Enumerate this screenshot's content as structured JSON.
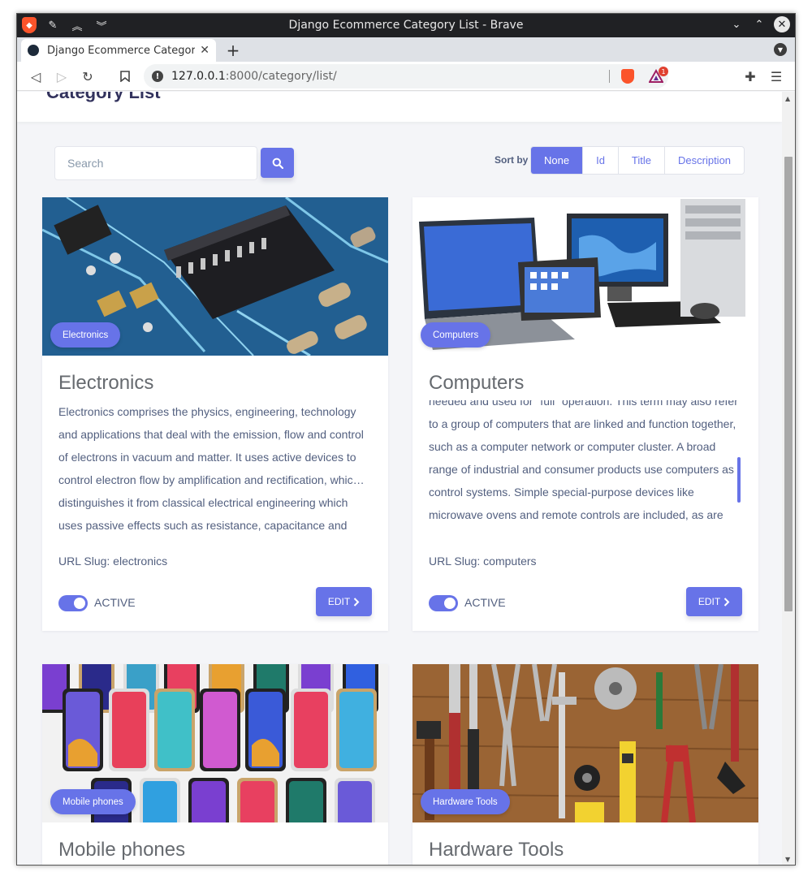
{
  "browser": {
    "window_title": "Django Ecommerce Category List - Brave",
    "tab_title": "Django Ecommerce Categor",
    "url_host": "127.0.0.1",
    "url_path": ":8000/category/list/",
    "rewards_badge": "1"
  },
  "page": {
    "title": "Category List",
    "search_placeholder": "Search",
    "sort_label": "Sort by",
    "sort_options": [
      "None",
      "Id",
      "Title",
      "Description"
    ],
    "sort_active": "None"
  },
  "categories": [
    {
      "badge": "Electronics",
      "title": "Electronics",
      "description": "Electronics comprises the physics, engineering, technology and applications that deal with the emission, flow and control of electrons in vacuum and matter. It uses active devices to control electron flow by amplification and rectification, whic… distinguishes it from classical electrical engineering which uses passive effects such as resistance, capacitance and",
      "slug": "URL Slug: electronics",
      "status": "ACTIVE",
      "edit_label": "EDIT"
    },
    {
      "badge": "Computers",
      "title": "Computers",
      "description": "needed and used for \"full\" operation. This term may also refer to a group of computers that are linked and function together, such as a computer network or computer cluster. A broad range of industrial and consumer products use computers as control systems. Simple special-purpose devices like microwave ovens and remote controls are included, as are factory devices like industrial robots and",
      "slug": "URL Slug: computers",
      "status": "ACTIVE",
      "edit_label": "EDIT"
    },
    {
      "badge": "Mobile phones",
      "title": "Mobile phones"
    },
    {
      "badge": "Hardware Tools",
      "title": "Hardware Tools"
    }
  ],
  "colors": {
    "primary": "#6773e8",
    "heading": "#32325d",
    "text": "#525f7f",
    "background": "#f4f5f8"
  }
}
